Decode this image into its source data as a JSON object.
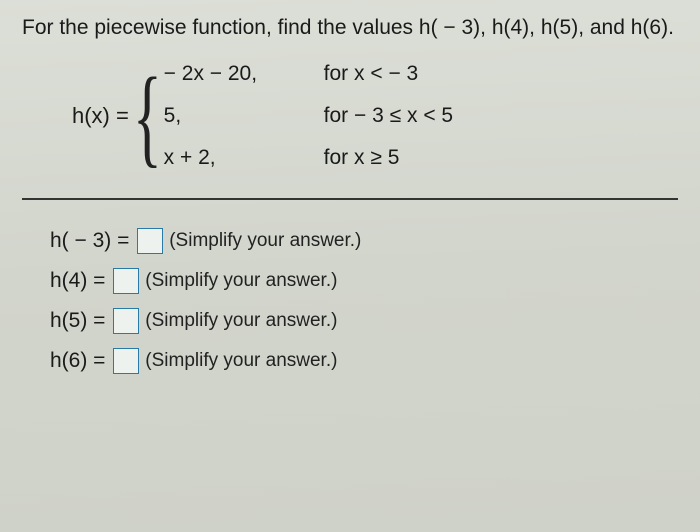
{
  "prompt": "For the piecewise function, find the values h( − 3), h(4), h(5), and h(6).",
  "piecewise": {
    "lhs": "h(x) =",
    "rows": [
      {
        "expr": "− 2x − 20,",
        "cond": "for x < − 3"
      },
      {
        "expr": "5,",
        "cond": "for − 3 ≤ x < 5"
      },
      {
        "expr": "x + 2,",
        "cond": "for x ≥ 5"
      }
    ]
  },
  "answers": [
    {
      "lhs": "h( − 3) = ",
      "hint": "(Simplify your answer.)"
    },
    {
      "lhs": "h(4) = ",
      "hint": "(Simplify your answer.)"
    },
    {
      "lhs": "h(5) = ",
      "hint": "(Simplify your answer.)"
    },
    {
      "lhs": "h(6) = ",
      "hint": "(Simplify your answer.)"
    }
  ]
}
